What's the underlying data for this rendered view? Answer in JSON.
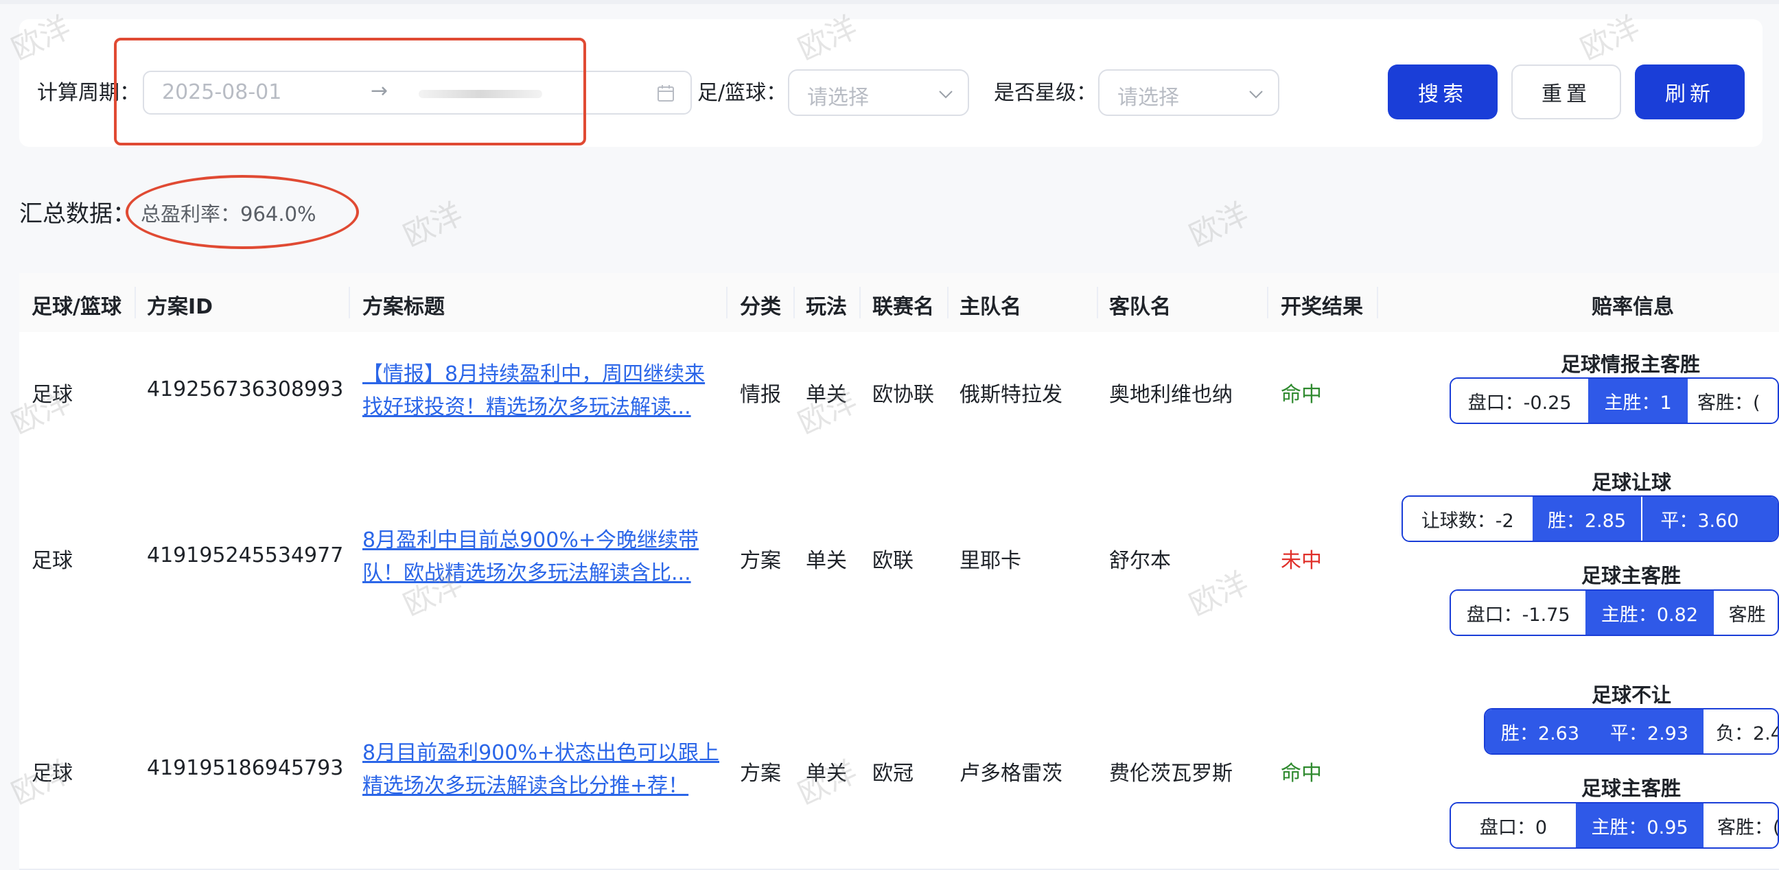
{
  "filters": {
    "period_label": "计算周期：",
    "date_start_placeholder": "2025-08-01",
    "date_separator": "→",
    "sport_label": "足/篮球：",
    "sport_placeholder": "请选择",
    "star_label": "是否星级：",
    "star_placeholder": "请选择",
    "search_button": "搜索",
    "reset_button": "重置",
    "refresh_button": "刷新"
  },
  "summary": {
    "title": "汇总数据：",
    "profit_rate": "总盈利率：964.0%"
  },
  "table": {
    "headers": [
      "足球/篮球",
      "方案ID",
      "方案标题",
      "分类",
      "玩法",
      "联赛名",
      "主队名",
      "客队名",
      "开奖结果",
      "赔率信息"
    ],
    "rows": [
      {
        "sport": "足球",
        "plan_id": "419256736308993",
        "title": "【情报】8月持续盈利中，周四继续来找好球投资！精选场次多玩法解读...",
        "category": "情报",
        "play": "单关",
        "league": "欧协联",
        "home": "俄斯特拉发",
        "away": "奥地利维也纳",
        "result": "命中",
        "result_status": "hit",
        "odds": [
          {
            "title": "足球情报主客胜",
            "segments": [
              {
                "text": "盘口：-0.25",
                "style": "w"
              },
              {
                "text": "主胜：1",
                "style": "b"
              },
              {
                "text": "客胜：(",
                "style": "w"
              }
            ]
          }
        ]
      },
      {
        "sport": "足球",
        "plan_id": "419195245534977",
        "title": "8月盈利中目前总900%+今晚继续带队！欧战精选场次多玩法解读含比...",
        "category": "方案",
        "play": "单关",
        "league": "欧联",
        "home": "里耶卡",
        "away": "舒尔本",
        "result": "未中",
        "result_status": "miss",
        "odds": [
          {
            "title": "足球让球",
            "segments": [
              {
                "text": "让球数：-2",
                "style": "w"
              },
              {
                "text": "胜：2.85",
                "style": "b"
              },
              {
                "text": "平：3.60",
                "style": "b"
              }
            ]
          },
          {
            "title": "足球主客胜",
            "segments": [
              {
                "text": "盘口：-1.75",
                "style": "w"
              },
              {
                "text": "主胜：0.82",
                "style": "b"
              },
              {
                "text": "客胜",
                "style": "w"
              }
            ]
          }
        ]
      },
      {
        "sport": "足球",
        "plan_id": "419195186945793",
        "title": "8月目前盈利900%+状态出色可以跟上精选场次多玩法解读含比分推+荐！",
        "category": "方案",
        "play": "单关",
        "league": "欧冠",
        "home": "卢多格雷茨",
        "away": "费伦茨瓦罗斯",
        "result": "命中",
        "result_status": "hit",
        "odds": [
          {
            "title": "足球不让",
            "segments": [
              {
                "text": "胜：2.63",
                "style": "b"
              },
              {
                "text": "平：2.93",
                "style": "b"
              },
              {
                "text": "负：2.4",
                "style": "w"
              }
            ]
          },
          {
            "title": "足球主客胜",
            "segments": [
              {
                "text": "盘口：0",
                "style": "w"
              },
              {
                "text": "主胜：0.95",
                "style": "b"
              },
              {
                "text": "客胜：(",
                "style": "w"
              }
            ]
          }
        ]
      }
    ]
  },
  "watermark": "欧洋",
  "colors": {
    "primary": "#1a3ed8",
    "odds_fill": "#2f59e8",
    "link": "#2b66e8",
    "hit": "#2f8a2f",
    "miss": "#e0302a",
    "annotation": "#e04a33"
  }
}
